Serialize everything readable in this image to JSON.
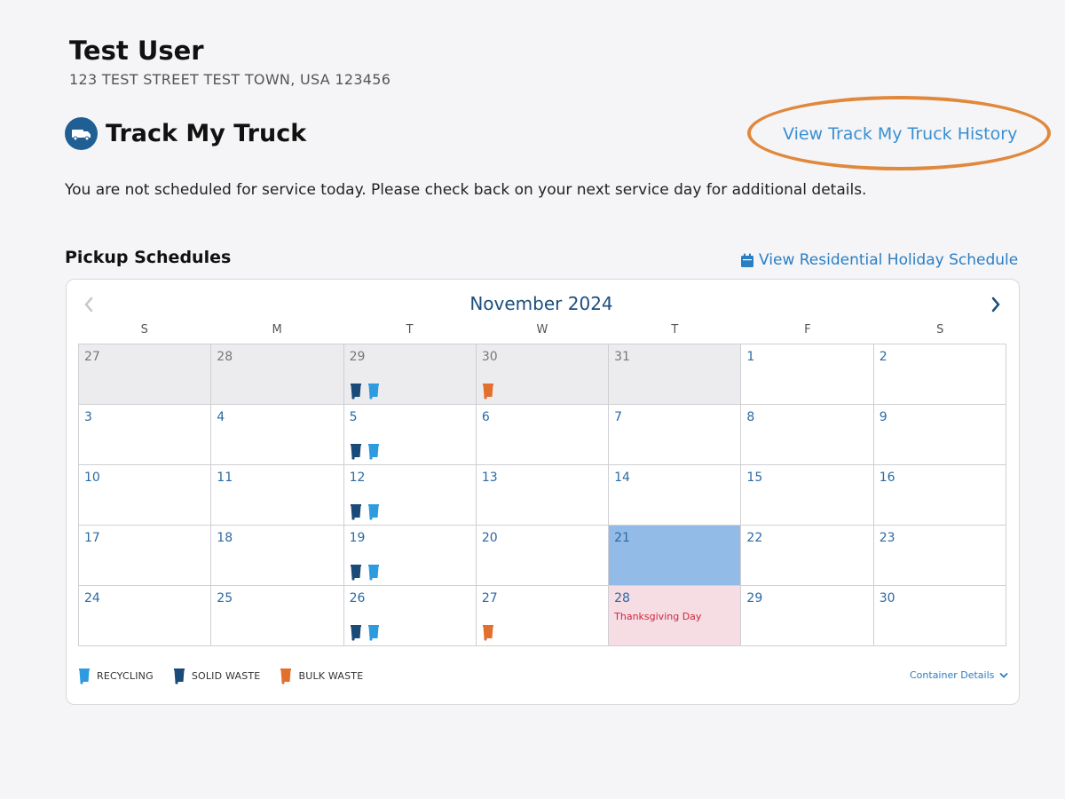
{
  "user": {
    "name": "Test User",
    "address": "123 TEST STREET TEST TOWN, USA 123456"
  },
  "track": {
    "title": "Track My Truck",
    "icon": "truck-icon",
    "history_link": "View Track My Truck History",
    "notice": "You are not scheduled for service today. Please check back on your next service day for additional details."
  },
  "pickup": {
    "title": "Pickup Schedules",
    "holiday_link": "View Residential Holiday Schedule",
    "holiday_icon": "calendar-icon"
  },
  "calendar": {
    "month": "November 2024",
    "weekdays": [
      "S",
      "M",
      "T",
      "W",
      "T",
      "F",
      "S"
    ],
    "days": [
      {
        "n": "27",
        "other": true
      },
      {
        "n": "28",
        "other": true
      },
      {
        "n": "29",
        "other": true,
        "bins": [
          "solid",
          "recycling"
        ]
      },
      {
        "n": "30",
        "other": true,
        "bins": [
          "bulk"
        ]
      },
      {
        "n": "31",
        "other": true
      },
      {
        "n": "1"
      },
      {
        "n": "2"
      },
      {
        "n": "3"
      },
      {
        "n": "4"
      },
      {
        "n": "5",
        "bins": [
          "solid",
          "recycling"
        ]
      },
      {
        "n": "6"
      },
      {
        "n": "7"
      },
      {
        "n": "8"
      },
      {
        "n": "9"
      },
      {
        "n": "10"
      },
      {
        "n": "11"
      },
      {
        "n": "12",
        "bins": [
          "solid",
          "recycling"
        ]
      },
      {
        "n": "13"
      },
      {
        "n": "14"
      },
      {
        "n": "15"
      },
      {
        "n": "16"
      },
      {
        "n": "17"
      },
      {
        "n": "18"
      },
      {
        "n": "19",
        "bins": [
          "solid",
          "recycling"
        ]
      },
      {
        "n": "20"
      },
      {
        "n": "21",
        "today": true
      },
      {
        "n": "22"
      },
      {
        "n": "23"
      },
      {
        "n": "24"
      },
      {
        "n": "25"
      },
      {
        "n": "26",
        "bins": [
          "solid",
          "recycling"
        ]
      },
      {
        "n": "27",
        "bins": [
          "bulk"
        ]
      },
      {
        "n": "28",
        "holiday": "Thanksgiving Day"
      },
      {
        "n": "29"
      },
      {
        "n": "30"
      }
    ]
  },
  "legend": [
    {
      "key": "recycling",
      "label": "RECYCLING"
    },
    {
      "key": "solid",
      "label": "SOLID WASTE"
    },
    {
      "key": "bulk",
      "label": "BULK WASTE"
    }
  ],
  "container_details": "Container Details",
  "colors": {
    "recycling": "#2e9be0",
    "solid": "#1a4a78",
    "bulk": "#e36f2c",
    "today": "#93bbe8",
    "holiday_bg": "#f6dce3",
    "highlight_circle": "#e0883c"
  }
}
